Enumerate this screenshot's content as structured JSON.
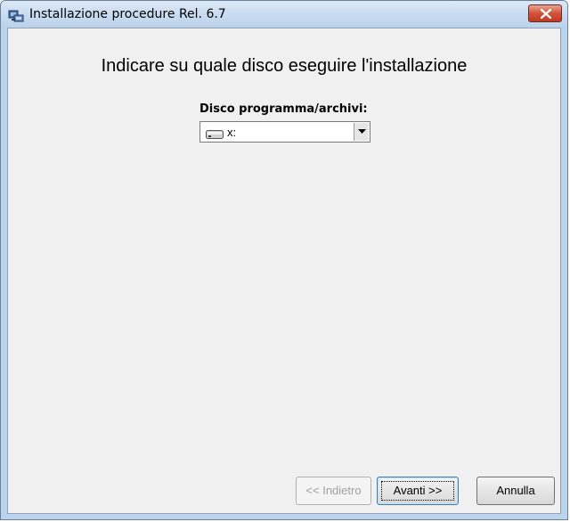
{
  "window": {
    "title": "Installazione procedure Rel. 6.7",
    "close_icon": "close-icon"
  },
  "main": {
    "heading": "Indicare su quale disco eseguire l'installazione",
    "drive_label": "Disco programma/archivi:",
    "drive_value": "x:",
    "drive_icon": "drive-icon"
  },
  "buttons": {
    "back": "<< Indietro",
    "back_enabled": false,
    "next": "Avanti >>",
    "cancel": "Annulla"
  },
  "colors": {
    "title_bar": "#c9dcf1",
    "close_button": "#d1523a",
    "client_bg": "#f0f0f0"
  }
}
